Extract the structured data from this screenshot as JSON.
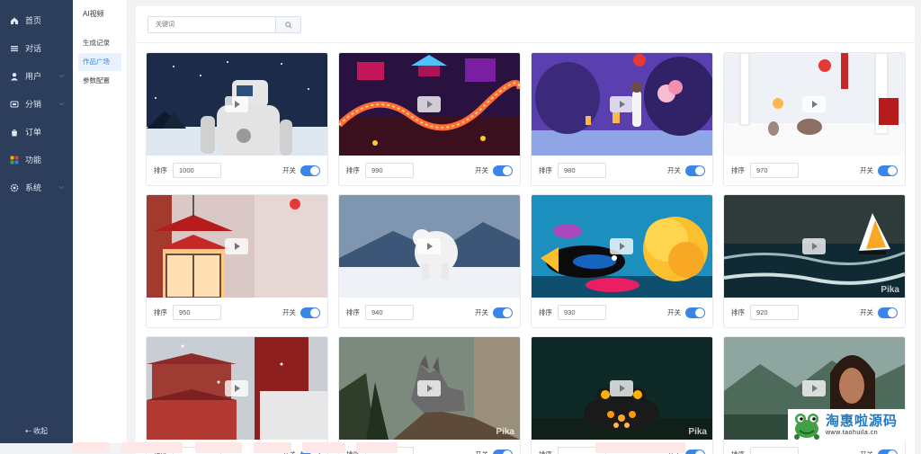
{
  "nav": {
    "items": [
      {
        "label": "首页",
        "icon": "home-icon",
        "has_chevron": false
      },
      {
        "label": "对话",
        "icon": "list-icon",
        "has_chevron": false
      },
      {
        "label": "用户",
        "icon": "user-icon",
        "has_chevron": true
      },
      {
        "label": "分销",
        "icon": "share-icon",
        "has_chevron": true
      },
      {
        "label": "订单",
        "icon": "bag-icon",
        "has_chevron": false
      },
      {
        "label": "功能",
        "icon": "apps-icon",
        "has_chevron": false
      },
      {
        "label": "系统",
        "icon": "gear-icon",
        "has_chevron": true
      }
    ],
    "collapse_label": "收起"
  },
  "subnav": {
    "title": "AI视频",
    "items": [
      {
        "label": "生成记录",
        "active": false
      },
      {
        "label": "作品广场",
        "active": true
      },
      {
        "label": "参数配置",
        "active": false
      }
    ]
  },
  "search": {
    "placeholder": "关键词",
    "value": ""
  },
  "card_labels": {
    "sort": "排序",
    "switch": "开关"
  },
  "cards": [
    {
      "sort": "1000",
      "enabled": true,
      "scene": "robot-snow",
      "watermark": ""
    },
    {
      "sort": "990",
      "enabled": true,
      "scene": "dragon-lights",
      "watermark": ""
    },
    {
      "sort": "980",
      "enabled": true,
      "scene": "lantern-night",
      "watermark": ""
    },
    {
      "sort": "970",
      "enabled": true,
      "scene": "snow-village",
      "watermark": ""
    },
    {
      "sort": "950",
      "enabled": true,
      "scene": "red-lantern",
      "watermark": ""
    },
    {
      "sort": "940",
      "enabled": true,
      "scene": "polar-bear",
      "watermark": ""
    },
    {
      "sort": "930",
      "enabled": true,
      "scene": "coral-fish",
      "watermark": ""
    },
    {
      "sort": "920",
      "enabled": true,
      "scene": "windsurf",
      "watermark": "Pika"
    },
    {
      "sort": "",
      "enabled": true,
      "scene": "palace-snow",
      "watermark": ""
    },
    {
      "sort": "",
      "enabled": true,
      "scene": "wolf-rock",
      "watermark": "Pika"
    },
    {
      "sort": "",
      "enabled": true,
      "scene": "glow-frog",
      "watermark": "Pika"
    },
    {
      "sort": "",
      "enabled": true,
      "scene": "warrior-woman",
      "watermark": ""
    }
  ],
  "brand": {
    "cn": "淘惠啦源码",
    "en": "www.taohuila.cn"
  },
  "colors": {
    "accent": "#3a86e8",
    "nav_bg": "#2c3e5b",
    "brand": "#1f7ac4"
  }
}
